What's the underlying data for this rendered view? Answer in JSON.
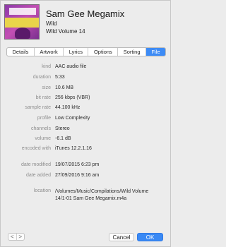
{
  "header": {
    "title": "Sam Gee Megamix",
    "artist": "Wild",
    "album": "Wild Volume 14",
    "artwork_icon": "album-artwork"
  },
  "tabs": [
    {
      "label": "Details",
      "active": false
    },
    {
      "label": "Artwork",
      "active": false
    },
    {
      "label": "Lyrics",
      "active": false
    },
    {
      "label": "Options",
      "active": false
    },
    {
      "label": "Sorting",
      "active": false
    },
    {
      "label": "File",
      "active": true
    }
  ],
  "file": {
    "kind_label": "kind",
    "kind": "AAC audio file",
    "duration_label": "duration",
    "duration": "5:33",
    "size_label": "size",
    "size": "10.6 MB",
    "bitrate_label": "bit rate",
    "bitrate": "256 kbps (VBR)",
    "samplerate_label": "sample rate",
    "samplerate": "44.100 kHz",
    "profile_label": "profile",
    "profile": "Low Complexity",
    "channels_label": "channels",
    "channels": "Stereo",
    "volume_label": "volume",
    "volume": "-6.1 dB",
    "encoded_label": "encoded with",
    "encoded": "iTunes 12.2.1.16",
    "modified_label": "date modified",
    "modified": "19/07/2015 6:23 pm",
    "added_label": "date added",
    "added": "27/09/2016 9:16 am",
    "location_label": "location",
    "location": "/Volumes/Music/Compilations/Wild Volume 14/1-01 Sam Gee Megamix.m4a"
  },
  "footer": {
    "prev_icon": "chevron-left-icon",
    "next_icon": "chevron-right-icon",
    "prev_glyph": "<",
    "next_glyph": ">",
    "cancel_label": "Cancel",
    "ok_label": "OK"
  },
  "colors": {
    "accent": "#3d8bf5",
    "label_gray": "#8e8e8e"
  }
}
